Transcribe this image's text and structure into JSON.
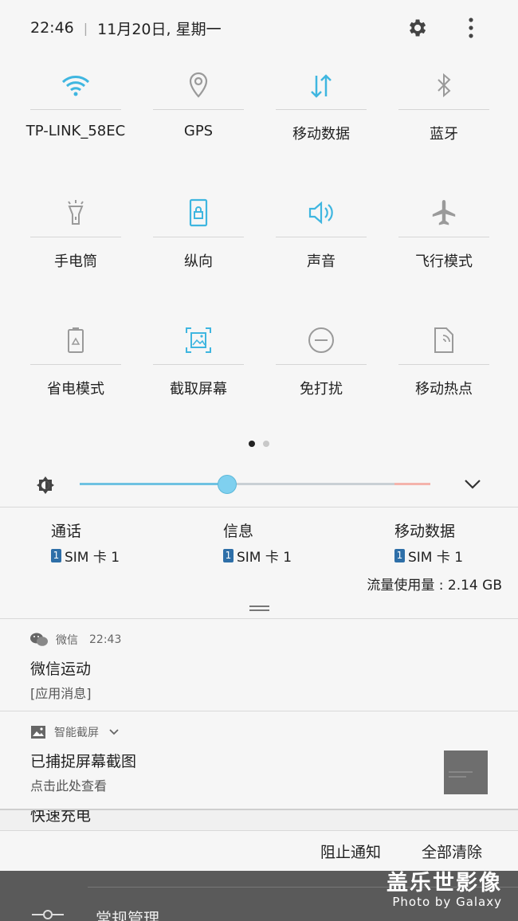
{
  "status": {
    "time": "22:46",
    "separator": "|",
    "date": "11月20日, 星期一"
  },
  "tiles": [
    {
      "label": "TP-LINK_58EC",
      "icon": "wifi-icon",
      "active": true
    },
    {
      "label": "GPS",
      "icon": "location-icon",
      "active": false
    },
    {
      "label": "移动数据",
      "icon": "mobile-data-icon",
      "active": true
    },
    {
      "label": "蓝牙",
      "icon": "bluetooth-icon",
      "active": false
    },
    {
      "label": "手电筒",
      "icon": "flashlight-icon",
      "active": false
    },
    {
      "label": "纵向",
      "icon": "portrait-lock-icon",
      "active": true
    },
    {
      "label": "声音",
      "icon": "sound-icon",
      "active": true
    },
    {
      "label": "飞行模式",
      "icon": "airplane-icon",
      "active": false
    },
    {
      "label": "省电模式",
      "icon": "battery-saver-icon",
      "active": false
    },
    {
      "label": "截取屏幕",
      "icon": "screenshot-icon",
      "active": true
    },
    {
      "label": "免打扰",
      "icon": "do-not-disturb-icon",
      "active": false
    },
    {
      "label": "移动热点",
      "icon": "hotspot-icon",
      "active": false
    }
  ],
  "brightness": {
    "level": 0.42
  },
  "sim": [
    {
      "label": "通话",
      "sim": "SIM 卡 1",
      "badge": "1"
    },
    {
      "label": "信息",
      "sim": "SIM 卡 1",
      "badge": "1"
    },
    {
      "label": "移动数据",
      "sim": "SIM 卡 1",
      "badge": "1"
    }
  ],
  "usage": "流量使用量 : 2.14 GB",
  "notifications": [
    {
      "app": "微信",
      "time": "22:43",
      "title": "微信运动",
      "body": "[应用消息]"
    },
    {
      "app": "智能截屏",
      "title": "已捕捉屏幕截图",
      "body": "点击此处查看"
    }
  ],
  "behind_text": "快速充电",
  "behind_menu": "常规管理",
  "actions": {
    "block": "阻止通知",
    "clear": "全部清除"
  },
  "watermark": {
    "line1": "盖乐世影像",
    "line2": "Photo by Galaxy"
  },
  "colors": {
    "accent": "#3fb6e0",
    "inactive": "#9a9a9a"
  }
}
